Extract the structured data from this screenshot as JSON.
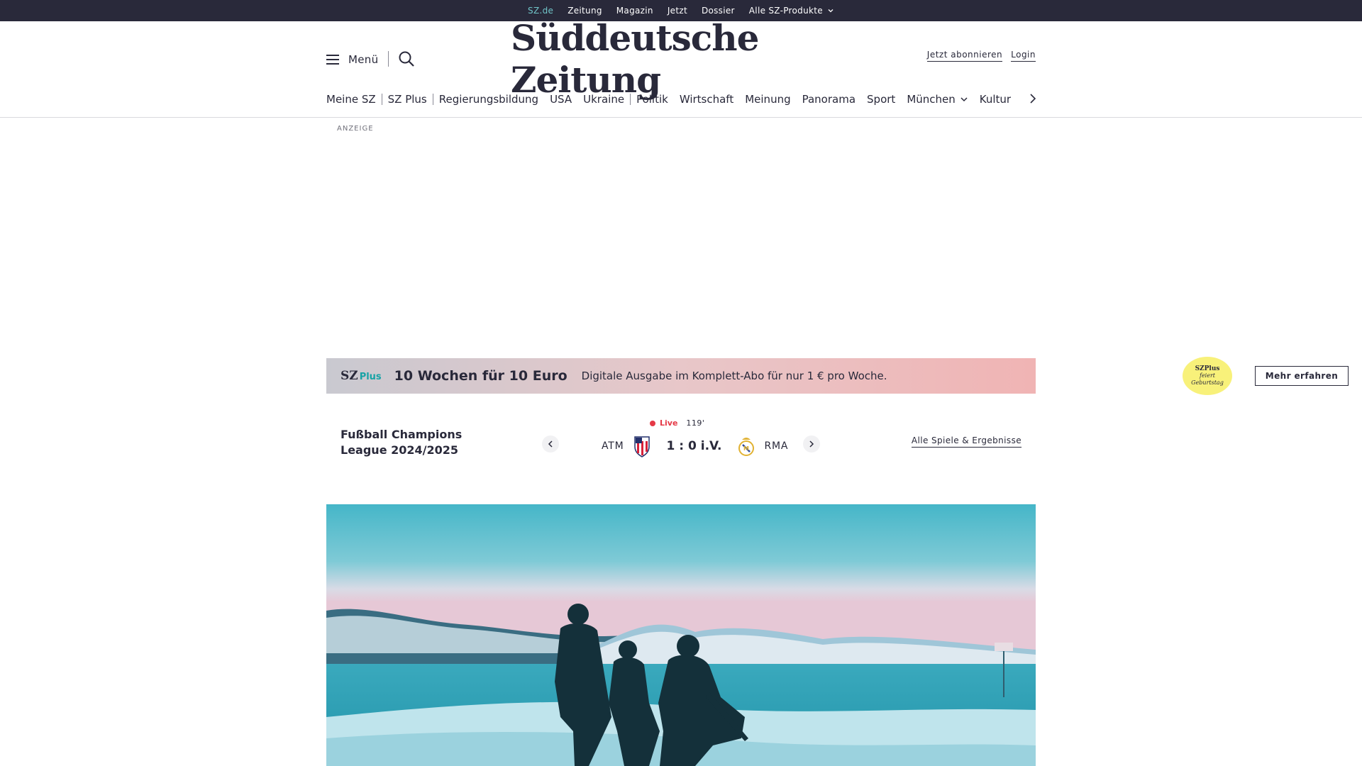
{
  "topbar": {
    "links": [
      {
        "label": "SZ.de"
      },
      {
        "label": "Zeitung"
      },
      {
        "label": "Magazin"
      },
      {
        "label": "Jetzt"
      },
      {
        "label": "Dossier"
      },
      {
        "label": "Alle SZ-Produkte"
      }
    ]
  },
  "header": {
    "menu_label": "Menü",
    "logo_text": "Süddeutsche Zeitung",
    "subscribe_label": "Jetzt abonnieren",
    "login_label": "Login"
  },
  "nav": {
    "items": [
      {
        "label": "Meine SZ"
      },
      {
        "label": "SZ Plus"
      },
      {
        "label": "Regierungsbildung"
      },
      {
        "label": "USA"
      },
      {
        "label": "Ukraine"
      },
      {
        "label": "Politik"
      },
      {
        "label": "Wirtschaft"
      },
      {
        "label": "Meinung"
      },
      {
        "label": "Panorama"
      },
      {
        "label": "Sport"
      },
      {
        "label": "München"
      },
      {
        "label": "Kultur"
      }
    ]
  },
  "ad": {
    "label": "ANZEIGE"
  },
  "promo": {
    "logo_sz": "SZ",
    "logo_plus": "Plus",
    "headline": "10 Wochen für 10 Euro",
    "text": "Digitale Ausgabe im Komplett-Abo für nur 1 € pro Woche.",
    "badge_line1": "SZPlus",
    "badge_line2": "feiert",
    "badge_line3": "Geburtstag",
    "button_label": "Mehr erfahren"
  },
  "scores": {
    "league": "Fußball Champions League 2024/2025",
    "live_label": "Live",
    "minute": "119'",
    "home_team": "ATM",
    "away_team": "RMA",
    "score": "1 : 0 i.V.",
    "all_games_label": "Alle Spiele & Ergebnisse"
  },
  "colors": {
    "dark": "#29293a",
    "accent": "#71c5c9",
    "live": "#e53946",
    "promo_yellow": "#f8f17a"
  }
}
